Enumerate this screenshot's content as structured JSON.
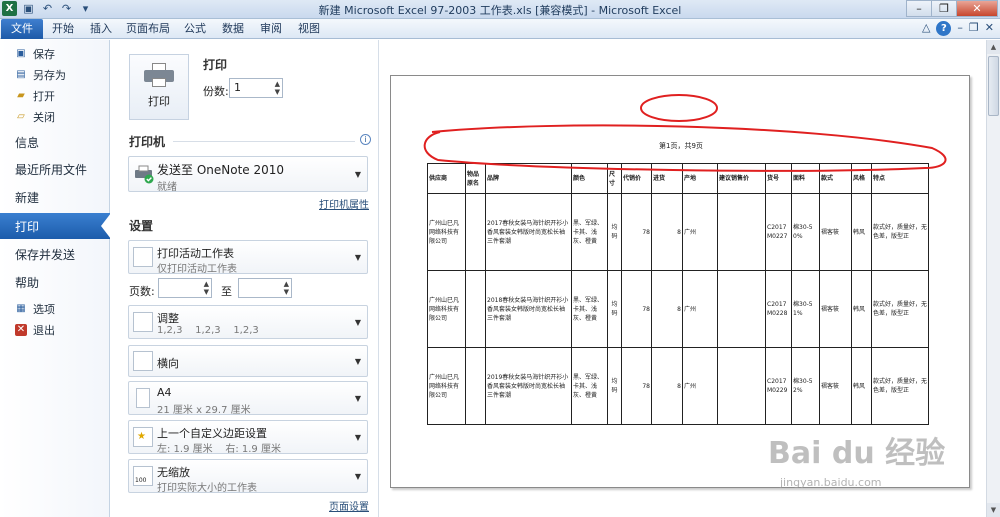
{
  "window": {
    "title": "新建 Microsoft Excel 97-2003 工作表.xls [兼容模式] - Microsoft Excel",
    "controls": {
      "minimize": "–",
      "restore": "❐",
      "close": "✕"
    }
  },
  "ribbon": {
    "tabs": [
      "文件",
      "开始",
      "插入",
      "页面布局",
      "公式",
      "数据",
      "审阅",
      "视图"
    ],
    "accent": "#1d5aa8"
  },
  "nav": {
    "save": "保存",
    "save_as": "另存为",
    "open": "打开",
    "close": "关闭",
    "info": "信息",
    "recent": "最近所用文件",
    "new": "新建",
    "print": "打印",
    "save_send": "保存并发送",
    "help": "帮助",
    "options": "选项",
    "exit": "退出"
  },
  "print": {
    "heading": "打印",
    "button_label": "打印",
    "copies_label": "份数:",
    "copies_value": "1",
    "printer_heading": "打印机",
    "printer_name": "发送至 OneNote 2010",
    "printer_status": "就绪",
    "printer_props": "打印机属性",
    "settings_heading": "设置",
    "what": {
      "title": "打印活动工作表",
      "sub": "仅打印活动工作表"
    },
    "pages_label": "页数:",
    "pages_to": "至",
    "collate": {
      "title": "调整",
      "sub": "1,2,3    1,2,3    1,2,3"
    },
    "orientation": {
      "title": "横向"
    },
    "paper": {
      "title": "A4",
      "sub": "21 厘米 x 29.7 厘米"
    },
    "margins": {
      "title": "上一个自定义边距设置",
      "sub": "左: 1.9 厘米    右: 1.9 厘米"
    },
    "scaling": {
      "title": "无缩放",
      "sub": "打印实际大小的工作表"
    },
    "page_setup": "页面设置"
  },
  "preview": {
    "page_label": "第1页，共9页",
    "headers": [
      "供应商",
      "物品原名",
      "品牌",
      "颜色",
      "尺寸",
      "代销价",
      "进货",
      "产地",
      "建议销售价",
      "货号",
      "面料",
      "款式",
      "风格",
      "特点"
    ],
    "rows": [
      [
        "广州山巳凡网络科技有限公司",
        "",
        "2017春秋女装马海针织开衫小香风套装女韩版时尚宽松长袖三件套潮",
        "黑、军绿、卡其、浅灰、橙黄",
        "均码",
        "78",
        "8",
        "广州",
        "",
        "C2017M0227",
        "棉30-50%",
        "褶客筱",
        "韩风",
        "款式好，质量好，无色差，版型正"
      ],
      [
        "广州山巳凡网络科技有限公司",
        "",
        "2018春秋女装马海针织开衫小香风套装女韩版时尚宽松长袖三件套潮",
        "黑、军绿、卡其、浅灰、橙黄",
        "均码",
        "78",
        "8",
        "广州",
        "",
        "C2017M0228",
        "棉30-51%",
        "褶客筱",
        "韩风",
        "款式好，质量好，无色差，版型正"
      ],
      [
        "广州山巳凡网络科技有限公司",
        "",
        "2019春秋女装马海针织开衫小香风套装女韩版时尚宽松长袖三件套潮",
        "黑、军绿、卡其、浅灰、橙黄",
        "均码",
        "78",
        "8",
        "广州",
        "",
        "C2017M0229",
        "棉30-52%",
        "褶客筱",
        "韩风",
        "款式好，质量好，无色差，版型正"
      ]
    ],
    "annotation_color": "#e02020"
  },
  "watermark": {
    "brand": "Bai du 经验",
    "url": "jingyan.baidu.com"
  }
}
